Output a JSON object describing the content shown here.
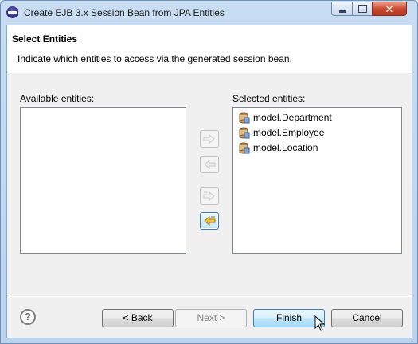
{
  "window": {
    "title": "Create EJB 3.x Session Bean from JPA Entities",
    "controls": {
      "minimize": "minimize",
      "maximize": "maximize",
      "close": "close"
    }
  },
  "banner": {
    "title": "Select Entities",
    "description": "Indicate which entities to access via the generated session bean."
  },
  "available": {
    "label": "Available entities:",
    "items": []
  },
  "selected": {
    "label": "Selected entities:",
    "items": [
      {
        "label": "model.Department",
        "icon": "entity-icon"
      },
      {
        "label": "model.Employee",
        "icon": "entity-icon"
      },
      {
        "label": "model.Location",
        "icon": "entity-icon"
      }
    ]
  },
  "transfer_buttons": [
    {
      "icon": "move-right-icon",
      "enabled": false
    },
    {
      "icon": "move-left-icon",
      "enabled": false
    },
    {
      "icon": "move-all-right-icon",
      "enabled": false
    },
    {
      "icon": "move-all-left-icon",
      "enabled": true
    }
  ],
  "footer": {
    "help_icon": "?",
    "back_label": "< Back",
    "next_label": "Next >",
    "finish_label": "Finish",
    "cancel_label": "Cancel"
  },
  "colors": {
    "accent_border": "#3c7fb1",
    "close_button": "#c8462e",
    "arrow_enabled": "#e8a91b"
  }
}
